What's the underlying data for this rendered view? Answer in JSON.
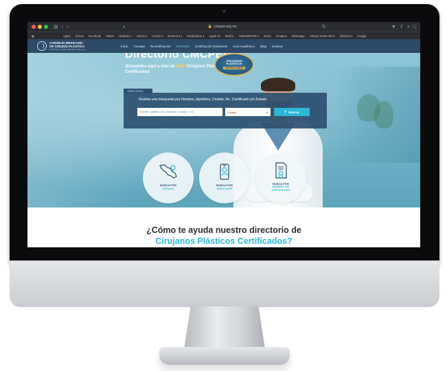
{
  "browser": {
    "url": "cmcper.org.mx",
    "bookmarks": [
      "Apple",
      "iCloud",
      "Facebook",
      "Twitter",
      "Noticias ▾",
      "Videos ▾",
      "Vuelos ▾",
      "BANCOS ▾",
      "Parabolicos ▾",
      "Apple ID",
      "MuDhL",
      "MailCMCPER ▾",
      "Zoom",
      "Dropbox",
      "Whatsapp",
      "Linksys Smart Wi-Fi",
      "Diseños ▾",
      "Google"
    ]
  },
  "site": {
    "logo_line1": "CONSEJO MEXICANO",
    "logo_line2": "DE CIRUGÍA PLÁSTICA",
    "logo_line3": "ESTÉTICA Y RECONSTRUCTIVA, A.C.",
    "menu": [
      {
        "label": "Inicio",
        "active": false
      },
      {
        "label": "Consejo",
        "active": false
      },
      {
        "label": "Recertificación",
        "active": false
      },
      {
        "label": "Directorio",
        "active": true
      },
      {
        "label": "Certificación Exámenes",
        "active": false
      },
      {
        "label": "Aval Académico",
        "active": false
      },
      {
        "label": "Blog",
        "active": false
      },
      {
        "label": "Noticias",
        "active": false
      }
    ]
  },
  "hero": {
    "title": "Directorio CMCPER",
    "subtitle_prefix": "¡Encuentra aquí a más de ",
    "subtitle_highlight": "2000",
    "subtitle_suffix": " Cirujanos Plásticos Certificados!",
    "seal_line1": "CIRUJANOS",
    "seal_line2": "PLÁSTICOS",
    "seal_ribbon": "CERTIFICADOS"
  },
  "search": {
    "tab_label": "DIRECTORIO",
    "caption": "Realiza una búsqueda por Nombre, Apellidos, Ciudad, No. Certificado y/o Estado",
    "input_placeholder": "Nombre, apellido o no. certificado / Ciudad / C.M.",
    "state_value": "Estado",
    "button_label": "Buscar"
  },
  "features": [
    {
      "line1": "BUSCA POR",
      "line2": "ESTADO",
      "line3": "",
      "icon": "map-icon"
    },
    {
      "line1": "BUSCA POR",
      "line2": "APELLIDOS",
      "line3": "",
      "icon": "id-badge-icon"
    },
    {
      "line1": "BUSCA POR",
      "line2": "NÚMERO DE",
      "line3": "CERTIFICADO",
      "icon": "certificate-icon"
    }
  ],
  "content": {
    "headline": "¿Cómo te ayuda nuestro directorio de",
    "headline_accent": "Cirujanos Plásticos Certificados?"
  },
  "colors": {
    "nav": "#2d4a67",
    "accent": "#2db6d6",
    "highlight": "#ffd34d"
  }
}
